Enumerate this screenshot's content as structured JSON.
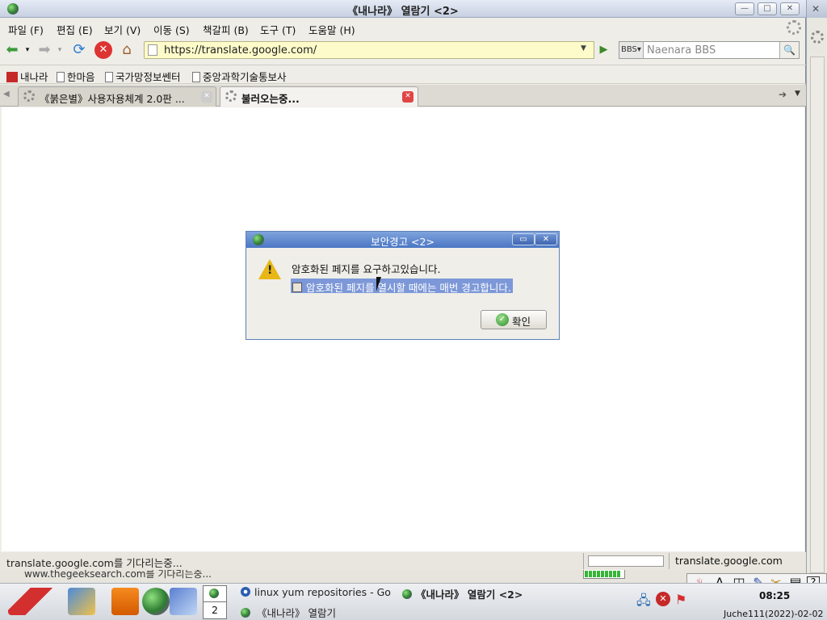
{
  "window": {
    "title": "《내나라》 열람기 <2>"
  },
  "menu": [
    "파일 (F)",
    "편집 (E)",
    "보기 (V)",
    "이동 (S)",
    "책갈피 (B)",
    "도구 (T)",
    "도움말 (H)"
  ],
  "nav": {
    "url": "https://translate.google.com/",
    "search_engine": "BBS",
    "search_placeholder": "Naenara BBS"
  },
  "bookmarks": [
    "내나라",
    "한마음",
    "국가망정보쎈터",
    "중앙과학기술통보사"
  ],
  "tabs": [
    {
      "label": "《붉은별》사용자용체계 2.0판 ..."
    },
    {
      "label": "불러오는중..."
    }
  ],
  "status": {
    "text": "translate.google.com를 기다리는중...",
    "host": "translate.google.com"
  },
  "behind_status": "www.thegeeksearch.com를 기다리는중...",
  "dialog": {
    "title": "보안경고 <2>",
    "message": "암호화된 페지를 요구하고있습니다.",
    "checkbox": "암호화된 페지를 열시할 때에는 매번 경고합니다.",
    "ok": "확인"
  },
  "taskbar": {
    "pager": "2",
    "tasks": [
      "linux yum repositories - Go",
      "《내나라》 열람기 <2>",
      "《내나라》 열람기"
    ],
    "clock": "08:25",
    "date": "Juche111(2022)-02-02"
  },
  "colors": {
    "url_bg": "#fdfbc9",
    "dialog_title": "#4a76c4",
    "selection": "#7d98d8"
  }
}
